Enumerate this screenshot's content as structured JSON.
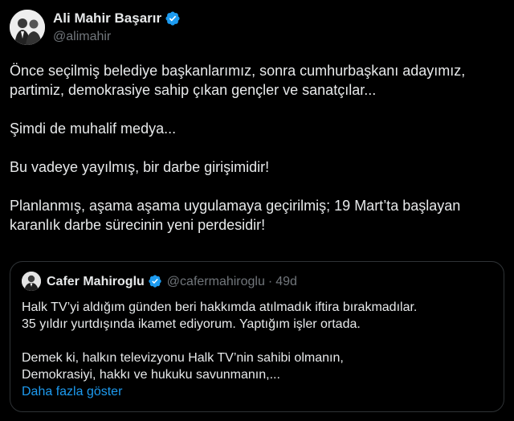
{
  "author": {
    "name": "Ali Mahir Başarır",
    "handle": "@alimahir"
  },
  "tweet_lines": [
    "Önce seçilmiş belediye başkanlarımız, sonra cumhurbaşkanı adayımız,",
    "partimiz, demokrasiye sahip çıkan gençler ve sanatçılar...",
    "Şimdi de muhalif medya...",
    "Bu vadeye yayılmış, bir darbe girişimidir!",
    "Planlanmış, aşama aşama uygulamaya geçirilmiş; 19 Mart’ta başlayan",
    "karanlık darbe sürecinin yeni perdesidir!"
  ],
  "quoted": {
    "name": "Cafer Mahiroglu",
    "handle": "@cafermahiroglu",
    "separator": "·",
    "time": "49d",
    "lines": [
      "Halk TV’yi aldığım günden beri hakkımda atılmadık iftira bırakmadılar.",
      "35 yıldır yurtdışında ikamet ediyorum. Yaptığım işler ortada.",
      "Demek ki, halkın televizyonu Halk TV’nin sahibi olmanın,",
      "Demokrasiyi, hakkı ve hukuku savunmanın,..."
    ],
    "show_more": "Daha fazla göster"
  },
  "colors": {
    "background": "#000000",
    "text": "#e7e9ea",
    "secondary": "#71767b",
    "accent": "#1d9bf0",
    "border": "#2f3336"
  },
  "icons": [
    "verified-badge-icon"
  ]
}
